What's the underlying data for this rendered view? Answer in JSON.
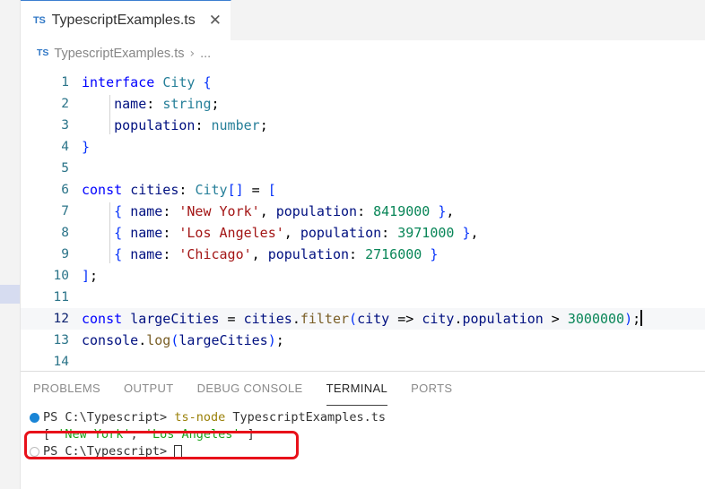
{
  "window": {
    "app": "Visual Studio Code",
    "theme": "light"
  },
  "tabbar": {
    "tabs": [
      {
        "icon": "typescript-file-icon",
        "icon_text": "TS",
        "label": "TypescriptExamples.ts",
        "close_glyph": "✕",
        "active": true
      }
    ]
  },
  "breadcrumbs": {
    "icon_text": "TS",
    "items": [
      "TypescriptExamples.ts",
      "..."
    ],
    "separator": "›"
  },
  "editor": {
    "language": "typescript",
    "active_line": 12,
    "cursor": {
      "line": 12,
      "column": 62
    },
    "lines": [
      {
        "num": "1",
        "tokens": [
          {
            "t": "interface",
            "c": "t-kw"
          },
          {
            "t": " ",
            "c": "t-plain"
          },
          {
            "t": "City",
            "c": "t-type"
          },
          {
            "t": " ",
            "c": "t-plain"
          },
          {
            "t": "{",
            "c": "t-brace"
          }
        ]
      },
      {
        "num": "2",
        "tokens": [
          {
            "t": "    ",
            "c": "t-plain"
          },
          {
            "t": "name",
            "c": "t-prop"
          },
          {
            "t": ": ",
            "c": "t-plain"
          },
          {
            "t": "string",
            "c": "t-type"
          },
          {
            "t": ";",
            "c": "t-plain"
          }
        ]
      },
      {
        "num": "3",
        "tokens": [
          {
            "t": "    ",
            "c": "t-plain"
          },
          {
            "t": "population",
            "c": "t-prop"
          },
          {
            "t": ": ",
            "c": "t-plain"
          },
          {
            "t": "number",
            "c": "t-type"
          },
          {
            "t": ";",
            "c": "t-plain"
          }
        ]
      },
      {
        "num": "4",
        "tokens": [
          {
            "t": "}",
            "c": "t-brace"
          }
        ]
      },
      {
        "num": "5",
        "tokens": []
      },
      {
        "num": "6",
        "tokens": [
          {
            "t": "const",
            "c": "t-kw"
          },
          {
            "t": " ",
            "c": "t-plain"
          },
          {
            "t": "cities",
            "c": "t-var"
          },
          {
            "t": ": ",
            "c": "t-plain"
          },
          {
            "t": "City",
            "c": "t-type"
          },
          {
            "t": "[]",
            "c": "t-brace"
          },
          {
            "t": " = ",
            "c": "t-plain"
          },
          {
            "t": "[",
            "c": "t-brace"
          }
        ]
      },
      {
        "num": "7",
        "tokens": [
          {
            "t": "    ",
            "c": "t-plain"
          },
          {
            "t": "{",
            "c": "t-brace"
          },
          {
            "t": " ",
            "c": "t-plain"
          },
          {
            "t": "name",
            "c": "t-prop"
          },
          {
            "t": ": ",
            "c": "t-plain"
          },
          {
            "t": "'New York'",
            "c": "t-str"
          },
          {
            "t": ", ",
            "c": "t-plain"
          },
          {
            "t": "population",
            "c": "t-prop"
          },
          {
            "t": ": ",
            "c": "t-plain"
          },
          {
            "t": "8419000",
            "c": "t-num"
          },
          {
            "t": " ",
            "c": "t-plain"
          },
          {
            "t": "}",
            "c": "t-brace"
          },
          {
            "t": ",",
            "c": "t-plain"
          }
        ]
      },
      {
        "num": "8",
        "tokens": [
          {
            "t": "    ",
            "c": "t-plain"
          },
          {
            "t": "{",
            "c": "t-brace"
          },
          {
            "t": " ",
            "c": "t-plain"
          },
          {
            "t": "name",
            "c": "t-prop"
          },
          {
            "t": ": ",
            "c": "t-plain"
          },
          {
            "t": "'Los Angeles'",
            "c": "t-str"
          },
          {
            "t": ", ",
            "c": "t-plain"
          },
          {
            "t": "population",
            "c": "t-prop"
          },
          {
            "t": ": ",
            "c": "t-plain"
          },
          {
            "t": "3971000",
            "c": "t-num"
          },
          {
            "t": " ",
            "c": "t-plain"
          },
          {
            "t": "}",
            "c": "t-brace"
          },
          {
            "t": ",",
            "c": "t-plain"
          }
        ]
      },
      {
        "num": "9",
        "tokens": [
          {
            "t": "    ",
            "c": "t-plain"
          },
          {
            "t": "{",
            "c": "t-brace"
          },
          {
            "t": " ",
            "c": "t-plain"
          },
          {
            "t": "name",
            "c": "t-prop"
          },
          {
            "t": ": ",
            "c": "t-plain"
          },
          {
            "t": "'Chicago'",
            "c": "t-str"
          },
          {
            "t": ", ",
            "c": "t-plain"
          },
          {
            "t": "population",
            "c": "t-prop"
          },
          {
            "t": ": ",
            "c": "t-plain"
          },
          {
            "t": "2716000",
            "c": "t-num"
          },
          {
            "t": " ",
            "c": "t-plain"
          },
          {
            "t": "}",
            "c": "t-brace"
          }
        ]
      },
      {
        "num": "10",
        "tokens": [
          {
            "t": "]",
            "c": "t-brace"
          },
          {
            "t": ";",
            "c": "t-plain"
          }
        ]
      },
      {
        "num": "11",
        "tokens": []
      },
      {
        "num": "12",
        "active": true,
        "tokens": [
          {
            "t": "const",
            "c": "t-kw"
          },
          {
            "t": " ",
            "c": "t-plain"
          },
          {
            "t": "largeCities",
            "c": "t-var"
          },
          {
            "t": " = ",
            "c": "t-plain"
          },
          {
            "t": "cities",
            "c": "t-var"
          },
          {
            "t": ".",
            "c": "t-plain"
          },
          {
            "t": "filter",
            "c": "t-fn"
          },
          {
            "t": "(",
            "c": "t-paren"
          },
          {
            "t": "city",
            "c": "t-var"
          },
          {
            "t": " => ",
            "c": "t-plain"
          },
          {
            "t": "city",
            "c": "t-var"
          },
          {
            "t": ".",
            "c": "t-plain"
          },
          {
            "t": "population",
            "c": "t-prop"
          },
          {
            "t": " > ",
            "c": "t-plain"
          },
          {
            "t": "3000000",
            "c": "t-num"
          },
          {
            "t": ")",
            "c": "t-paren"
          },
          {
            "t": ";",
            "c": "t-plain"
          }
        ]
      },
      {
        "num": "13",
        "tokens": [
          {
            "t": "console",
            "c": "t-var"
          },
          {
            "t": ".",
            "c": "t-plain"
          },
          {
            "t": "log",
            "c": "t-fn"
          },
          {
            "t": "(",
            "c": "t-paren"
          },
          {
            "t": "largeCities",
            "c": "t-var"
          },
          {
            "t": ")",
            "c": "t-paren"
          },
          {
            "t": ";",
            "c": "t-plain"
          }
        ]
      },
      {
        "num": "14",
        "tokens": []
      }
    ]
  },
  "panel": {
    "tabs": [
      {
        "label": "PROBLEMS",
        "active": false
      },
      {
        "label": "OUTPUT",
        "active": false
      },
      {
        "label": "DEBUG CONSOLE",
        "active": false
      },
      {
        "label": "TERMINAL",
        "active": true
      },
      {
        "label": "PORTS",
        "active": false
      }
    ],
    "terminal": {
      "lines": [
        {
          "decoration": "success",
          "segments": [
            {
              "t": "PS C:\\Typescript> ",
              "c": "tm-prompt"
            },
            {
              "t": "ts-node",
              "c": "tm-cmd"
            },
            {
              "t": " TypescriptExamples.ts",
              "c": "tm-arg"
            }
          ]
        },
        {
          "decoration": "none",
          "segments": [
            {
              "t": "[ ",
              "c": "tm-punct"
            },
            {
              "t": "'New York'",
              "c": "tm-green"
            },
            {
              "t": ", ",
              "c": "tm-punct"
            },
            {
              "t": "'Los Angeles'",
              "c": "tm-green"
            },
            {
              "t": " ]",
              "c": "tm-punct"
            }
          ]
        },
        {
          "decoration": "pending",
          "cursor": true,
          "segments": [
            {
              "t": "PS C:\\Typescript> ",
              "c": "tm-prompt"
            }
          ]
        }
      ]
    }
  },
  "annotation": {
    "shape": "rounded-rectangle",
    "color": "#e8111a",
    "target_text": "[ 'New York', 'Los Angeles' ]"
  },
  "colors": {
    "accent": "#3178c6",
    "annotation": "#e8111a",
    "terminal_success": "#1a85d6",
    "terminal_output": "#19a319"
  }
}
